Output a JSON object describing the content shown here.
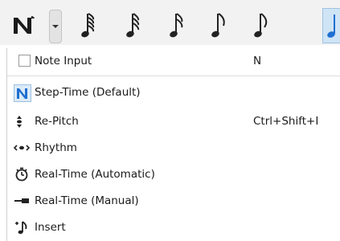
{
  "toolbar": {
    "mode_icon": "note-input-mode-icon",
    "dropdown_icon": "chevron-down-icon",
    "note_icons": [
      "sixty-fourth-note-icon",
      "thirty-second-note-icon",
      "sixteenth-note-icon",
      "eighth-note-icon",
      "eighth-note-icon",
      "quarter-note-icon"
    ],
    "accent_color": "#1f6fd1"
  },
  "menu": {
    "note_input": {
      "label": "Note Input",
      "shortcut": "N",
      "checked": false
    },
    "items": [
      {
        "label": "Step-Time (Default)",
        "icon": "step-time-icon",
        "shortcut": "",
        "selected": true
      },
      {
        "label": "Re-Pitch",
        "icon": "re-pitch-icon",
        "shortcut": "Ctrl+Shift+I",
        "selected": false
      },
      {
        "label": "Rhythm",
        "icon": "rhythm-icon",
        "shortcut": "",
        "selected": false
      },
      {
        "label": "Real-Time (Automatic)",
        "icon": "metronome-icon",
        "shortcut": "",
        "selected": false
      },
      {
        "label": "Real-Time (Manual)",
        "icon": "manual-tap-icon",
        "shortcut": "",
        "selected": false
      },
      {
        "label": "Insert",
        "icon": "insert-note-icon",
        "shortcut": "",
        "selected": false
      }
    ]
  }
}
